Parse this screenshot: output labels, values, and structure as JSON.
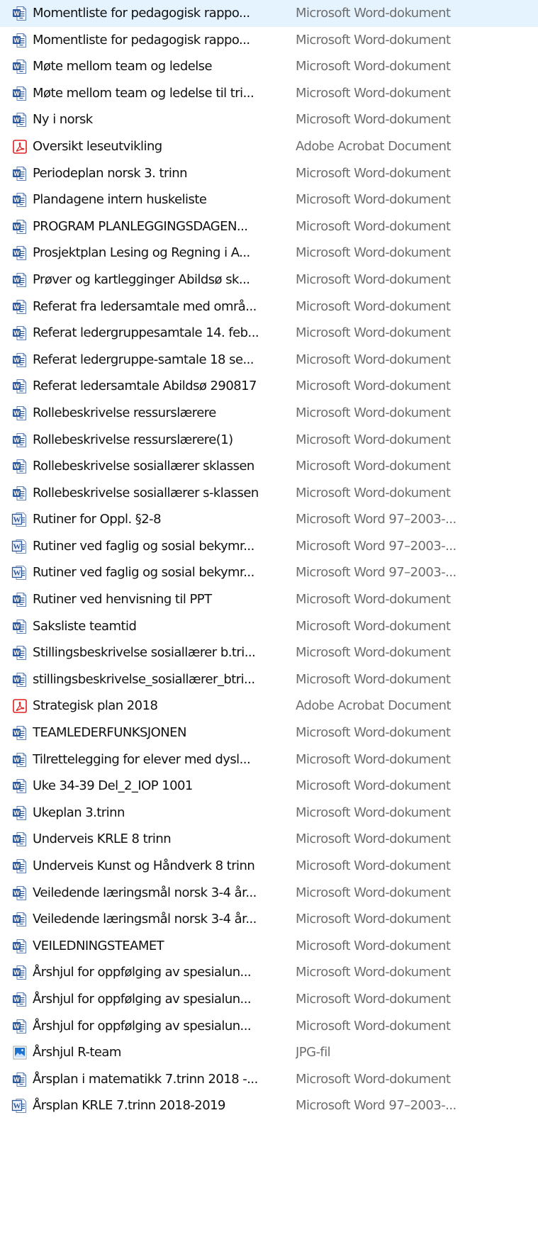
{
  "files": [
    {
      "name": "Momentliste for pedagogisk rappo...",
      "type": "Microsoft Word-dokument",
      "icon": "word-docx-icon"
    },
    {
      "name": "Momentliste for pedagogisk rappo...",
      "type": "Microsoft Word-dokument",
      "icon": "word-docx-icon"
    },
    {
      "name": "Møte mellom team og ledelse",
      "type": "Microsoft Word-dokument",
      "icon": "word-docx-icon"
    },
    {
      "name": "Møte mellom team og ledelse til tri...",
      "type": "Microsoft Word-dokument",
      "icon": "word-docx-icon"
    },
    {
      "name": "Ny i norsk",
      "type": "Microsoft Word-dokument",
      "icon": "word-docx-icon"
    },
    {
      "name": "Oversikt leseutvikling",
      "type": "Adobe Acrobat Document",
      "icon": "pdf-icon"
    },
    {
      "name": "Periodeplan norsk 3. trinn",
      "type": "Microsoft Word-dokument",
      "icon": "word-docx-icon"
    },
    {
      "name": "Plandagene intern huskeliste",
      "type": "Microsoft Word-dokument",
      "icon": "word-docx-icon"
    },
    {
      "name": "PROGRAM PLANLEGGINGSDAGEN...",
      "type": "Microsoft Word-dokument",
      "icon": "word-docx-icon"
    },
    {
      "name": "Prosjektplan Lesing og Regning i A...",
      "type": "Microsoft Word-dokument",
      "icon": "word-docx-icon"
    },
    {
      "name": "Prøver og kartlegginger Abildsø sk...",
      "type": "Microsoft Word-dokument",
      "icon": "word-docx-icon"
    },
    {
      "name": "Referat fra ledersamtale med områ...",
      "type": "Microsoft Word-dokument",
      "icon": "word-docx-icon"
    },
    {
      "name": "Referat ledergruppesamtale 14. feb...",
      "type": "Microsoft Word-dokument",
      "icon": "word-docx-icon"
    },
    {
      "name": "Referat ledergruppe-samtale 18 se...",
      "type": "Microsoft Word-dokument",
      "icon": "word-docx-icon"
    },
    {
      "name": "Referat ledersamtale Abildsø 290817",
      "type": "Microsoft Word-dokument",
      "icon": "word-docx-icon"
    },
    {
      "name": "Rollebeskrivelse ressurslærere",
      "type": "Microsoft Word-dokument",
      "icon": "word-docx-icon"
    },
    {
      "name": "Rollebeskrivelse ressurslærere(1)",
      "type": "Microsoft Word-dokument",
      "icon": "word-docx-icon"
    },
    {
      "name": "Rollebeskrivelse sosiallærer sklassen",
      "type": "Microsoft Word-dokument",
      "icon": "word-docx-icon"
    },
    {
      "name": "Rollebeskrivelse sosiallærer s-klassen",
      "type": "Microsoft Word-dokument",
      "icon": "word-docx-icon"
    },
    {
      "name": "Rutiner for Oppl. §2-8",
      "type": "Microsoft Word 97–2003-...",
      "icon": "word-doc-legacy-icon"
    },
    {
      "name": "Rutiner ved faglig og sosial bekymr...",
      "type": "Microsoft Word 97–2003-...",
      "icon": "word-doc-legacy-icon"
    },
    {
      "name": "Rutiner ved faglig og sosial bekymr...",
      "type": "Microsoft Word 97–2003-...",
      "icon": "word-doc-legacy-icon"
    },
    {
      "name": "Rutiner ved henvisning til PPT",
      "type": "Microsoft Word-dokument",
      "icon": "word-docx-icon"
    },
    {
      "name": "Saksliste teamtid",
      "type": "Microsoft Word-dokument",
      "icon": "word-docx-icon"
    },
    {
      "name": "Stillingsbeskrivelse sosiallærer b.tri...",
      "type": "Microsoft Word-dokument",
      "icon": "word-docx-icon"
    },
    {
      "name": "stillingsbeskrivelse_sosiallærer_btri...",
      "type": "Microsoft Word-dokument",
      "icon": "word-docx-icon"
    },
    {
      "name": "Strategisk plan 2018",
      "type": "Adobe Acrobat Document",
      "icon": "pdf-icon"
    },
    {
      "name": "TEAMLEDERFUNKSJONEN",
      "type": "Microsoft Word-dokument",
      "icon": "word-docx-icon"
    },
    {
      "name": "Tilrettelegging for elever med dysl...",
      "type": "Microsoft Word-dokument",
      "icon": "word-docx-icon"
    },
    {
      "name": "Uke 34-39 Del_2_IOP 1001",
      "type": "Microsoft Word-dokument",
      "icon": "word-docx-icon"
    },
    {
      "name": "Ukeplan 3.trinn",
      "type": "Microsoft Word-dokument",
      "icon": "word-docx-icon"
    },
    {
      "name": "Underveis KRLE 8 trinn",
      "type": "Microsoft Word-dokument",
      "icon": "word-docx-icon"
    },
    {
      "name": "Underveis Kunst og Håndverk 8 trinn",
      "type": "Microsoft Word-dokument",
      "icon": "word-docx-icon"
    },
    {
      "name": "Veiledende læringsmål norsk 3-4 år...",
      "type": "Microsoft Word-dokument",
      "icon": "word-docx-icon"
    },
    {
      "name": "Veiledende læringsmål norsk 3-4 år...",
      "type": "Microsoft Word-dokument",
      "icon": "word-docx-icon"
    },
    {
      "name": "VEILEDNINGSTEAMET",
      "type": "Microsoft Word-dokument",
      "icon": "word-docx-icon"
    },
    {
      "name": "Årshjul for oppfølging av spesialun...",
      "type": "Microsoft Word-dokument",
      "icon": "word-docx-icon"
    },
    {
      "name": "Årshjul for oppfølging av spesialun...",
      "type": "Microsoft Word-dokument",
      "icon": "word-docx-icon"
    },
    {
      "name": "Årshjul for oppfølging av spesialun...",
      "type": "Microsoft Word-dokument",
      "icon": "word-docx-icon"
    },
    {
      "name": "Årshjul R-team",
      "type": "JPG-fil",
      "icon": "image-jpg-icon"
    },
    {
      "name": "Årsplan i matematikk 7.trinn 2018 -...",
      "type": "Microsoft Word-dokument",
      "icon": "word-docx-icon"
    },
    {
      "name": "Årsplan KRLE 7.trinn 2018-2019",
      "type": "Microsoft Word 97–2003-...",
      "icon": "word-doc-legacy-icon"
    }
  ],
  "colors": {
    "name_text": "#111111",
    "type_text": "#6d6d6d",
    "word_blue": "#2b579a",
    "pdf_red": "#e02020",
    "image_blue": "#1e73d1"
  }
}
